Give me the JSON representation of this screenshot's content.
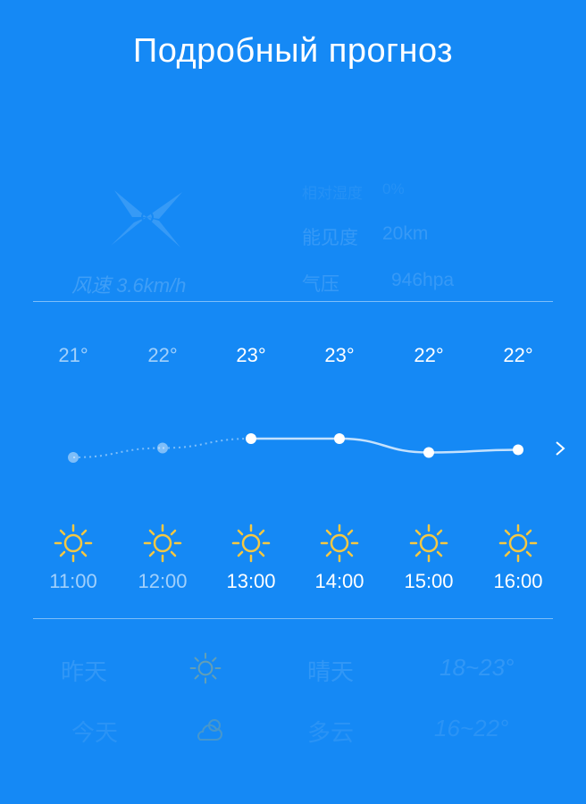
{
  "header": {
    "title": "Подробный прогноз"
  },
  "details": {
    "wind_label": "风速 3.6km/h",
    "humidity": {
      "label": "相对湿度",
      "value": "0%"
    },
    "visibility": {
      "label": "能见度",
      "value": "20km"
    },
    "pressure": {
      "label": "气压",
      "value": "946hpa"
    }
  },
  "hourly": [
    {
      "time": "11:00",
      "temp": "21°",
      "icon": "sun-icon",
      "past": true
    },
    {
      "time": "12:00",
      "temp": "22°",
      "icon": "sun-icon",
      "past": true
    },
    {
      "time": "13:00",
      "temp": "23°",
      "icon": "sun-icon",
      "past": false
    },
    {
      "time": "14:00",
      "temp": "23°",
      "icon": "sun-icon",
      "past": false
    },
    {
      "time": "15:00",
      "temp": "22°",
      "icon": "sun-icon",
      "past": false
    },
    {
      "time": "16:00",
      "temp": "22°",
      "icon": "sun-icon",
      "past": false
    }
  ],
  "chart_data": {
    "type": "line",
    "categories": [
      "11:00",
      "12:00",
      "13:00",
      "14:00",
      "15:00",
      "16:00"
    ],
    "series": [
      {
        "values": [
          21,
          22,
          23,
          23,
          22,
          22
        ]
      }
    ]
  },
  "daily": [
    {
      "day": "昨天",
      "icon": "sun-icon",
      "condition": "晴天",
      "range": "18~23°"
    },
    {
      "day": "今天",
      "icon": "partly-cloudy-icon",
      "condition": "多云",
      "range": "16~22°"
    }
  ],
  "colors": {
    "background": "#1589f5",
    "sun": "#f5c842",
    "text": "#ffffff"
  }
}
